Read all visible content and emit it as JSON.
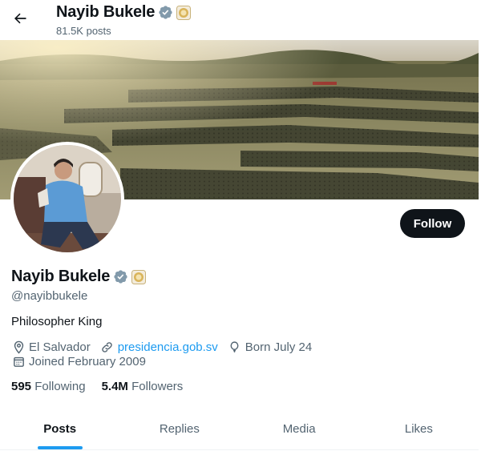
{
  "header": {
    "back_icon": "arrow-left-icon",
    "name": "Nayib Bukele",
    "posts": "81.5K posts"
  },
  "profile": {
    "name": "Nayib Bukele",
    "handle": "@nayibbukele",
    "bio": "Philosopher King",
    "verified_color": "#829aab",
    "follow_label": "Follow",
    "location": "El Salvador",
    "website": "presidencia.gob.sv",
    "born": "Born July 24",
    "joined": "Joined February 2009",
    "following_count": "595",
    "following_label": "Following",
    "followers_count": "5.4M",
    "followers_label": "Followers"
  },
  "tabs": [
    {
      "label": "Posts",
      "active": true
    },
    {
      "label": "Replies",
      "active": false
    },
    {
      "label": "Media",
      "active": false
    },
    {
      "label": "Likes",
      "active": false
    }
  ],
  "colors": {
    "accent": "#1d9bf0",
    "text": "#0f1419",
    "muted": "#536471",
    "button_bg": "#0f1419"
  }
}
